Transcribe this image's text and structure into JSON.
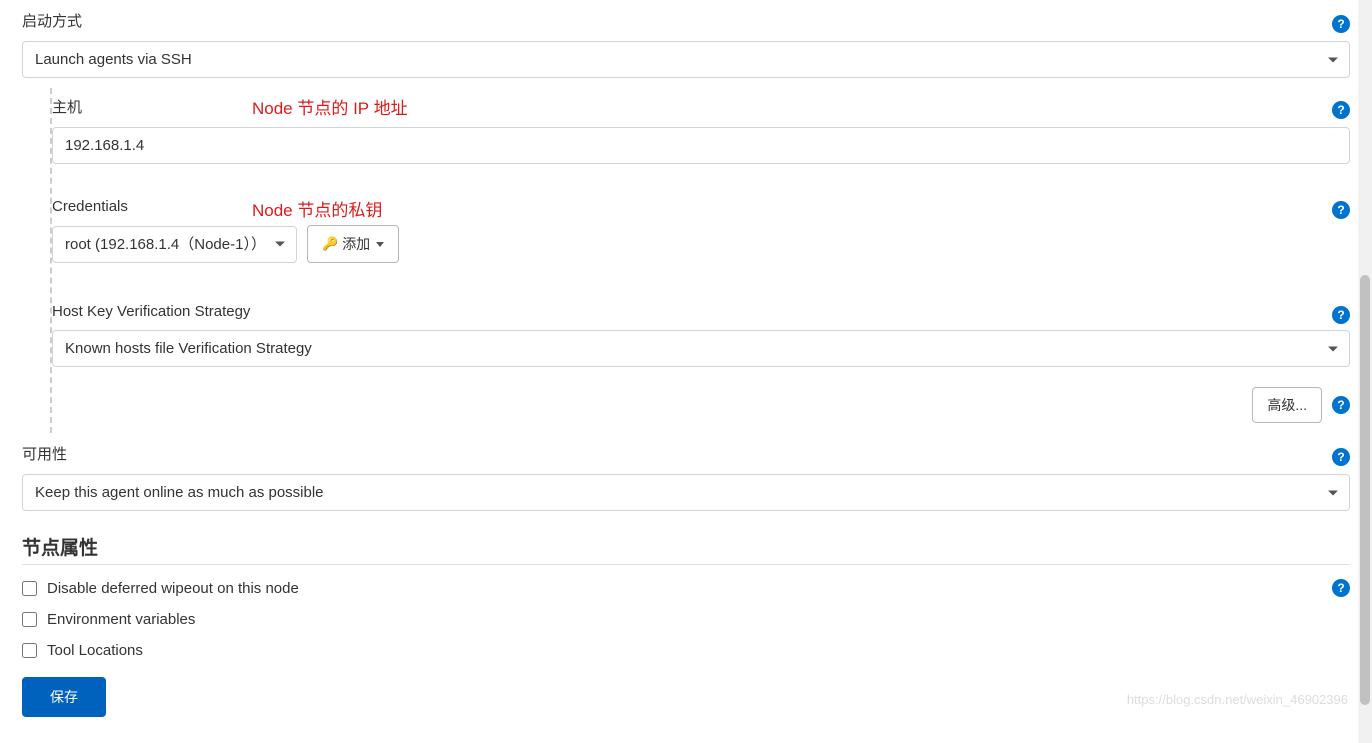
{
  "labels": {
    "launch_method": "启动方式",
    "host": "主机",
    "credentials": "Credentials",
    "host_key_strategy": "Host Key Verification Strategy",
    "availability": "可用性",
    "node_properties": "节点属性"
  },
  "annotations": {
    "host_ip": "Node 节点的 IP 地址",
    "private_key": "Node 节点的私钥"
  },
  "values": {
    "launch_method": "Launch agents via SSH",
    "host": "192.168.1.4",
    "credentials": "root (192.168.1.4（Node-1））",
    "host_key_strategy": "Known hosts file Verification Strategy",
    "availability": "Keep this agent online as much as possible"
  },
  "buttons": {
    "add": "添加",
    "advanced": "高级...",
    "save": "保存"
  },
  "checkboxes": {
    "disable_wipeout": "Disable deferred wipeout on this node",
    "env_vars": "Environment variables",
    "tool_locations": "Tool Locations"
  },
  "watermark": "https://blog.csdn.net/weixin_46902396"
}
